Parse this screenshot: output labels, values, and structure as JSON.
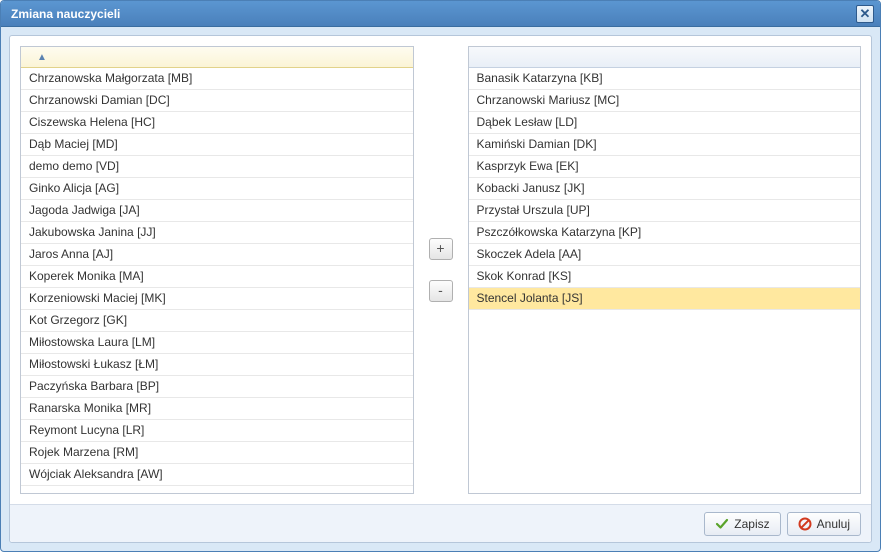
{
  "dialog": {
    "title": "Zmiana nauczycieli"
  },
  "leftList": {
    "selectedIndex": 19,
    "items": [
      "Chrzanowska Małgorzata [MB]",
      "Chrzanowski Damian [DC]",
      "Ciszewska Helena [HC]",
      "Dąb Maciej [MD]",
      "demo demo [VD]",
      "Ginko Alicja [AG]",
      "Jagoda Jadwiga [JA]",
      "Jakubowska Janina [JJ]",
      "Jaros Anna [AJ]",
      "Koperek Monika [MA]",
      "Korzeniowski Maciej [MK]",
      "Kot Grzegorz [GK]",
      "Miłostowska Laura [LM]",
      "Miłostowski Łukasz [ŁM]",
      "Paczyńska Barbara [BP]",
      "Ranarska Monika [MR]",
      "Reymont Lucyna [LR]",
      "Rojek Marzena [RM]",
      "Wójciak Aleksandra [AW]"
    ]
  },
  "rightList": {
    "selectedIndex": 10,
    "items": [
      "Banasik Katarzyna [KB]",
      "Chrzanowski Mariusz [MC]",
      "Dąbek Lesław [LD]",
      "Kamiński Damian [DK]",
      "Kasprzyk Ewa [EK]",
      "Kobacki Janusz [JK]",
      "Przystał Urszula [UP]",
      "Pszczółkowska Katarzyna [KP]",
      "Skoczek Adela [AA]",
      "Skok Konrad [KS]",
      "Stencel Jolanta [JS]"
    ]
  },
  "controls": {
    "add": "+",
    "remove": "-"
  },
  "footer": {
    "save": "Zapisz",
    "cancel": "Anuluj"
  }
}
